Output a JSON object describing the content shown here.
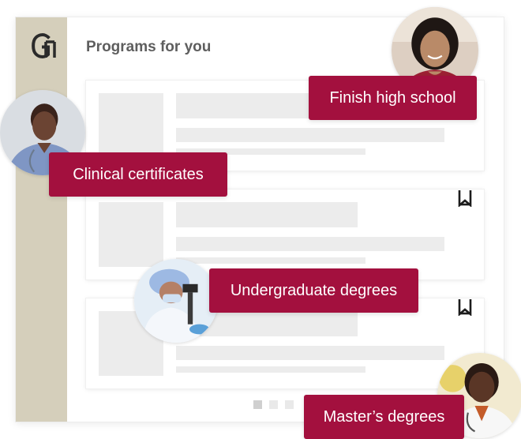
{
  "header": {
    "title": "Programs for you"
  },
  "brand": {
    "logo_icon": "college-monogram-logo",
    "primary_color": "#a3103e",
    "sidebar_color": "#d5cfbb"
  },
  "program_cards": [
    {
      "bookmark_icon": ""
    },
    {
      "bookmark_icon": "bookmark-icon"
    },
    {
      "bookmark_icon": "bookmark-icon"
    }
  ],
  "pagination": {
    "pages": 3,
    "active": 1
  },
  "program_tags": [
    {
      "label": "Finish high school"
    },
    {
      "label": "Clinical certificates"
    },
    {
      "label": "Undergraduate degrees"
    },
    {
      "label": "Master’s degrees"
    }
  ]
}
